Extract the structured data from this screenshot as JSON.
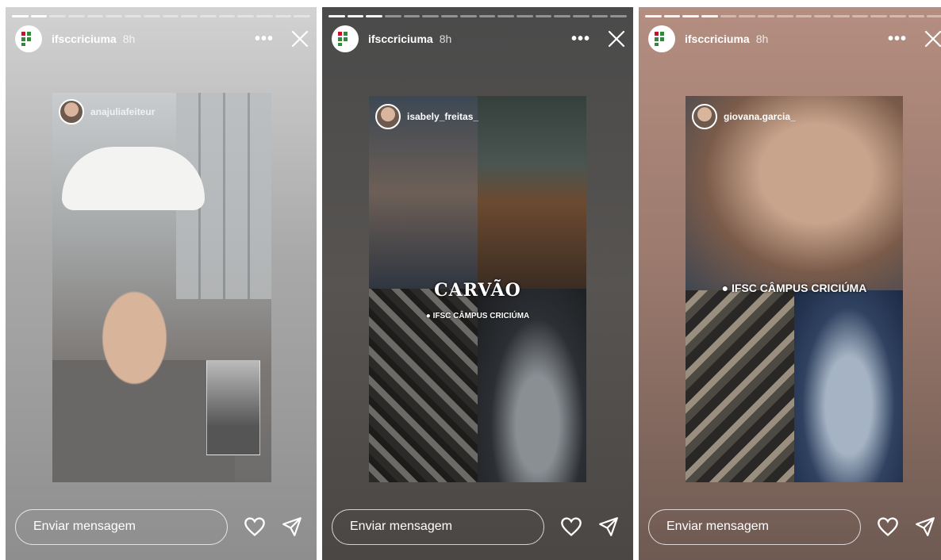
{
  "stories": [
    {
      "username": "ifsccriciuma",
      "time": "8h",
      "progress": {
        "total": 16,
        "completed": 2
      },
      "tagged_user": "anajuliafeiteur",
      "message_placeholder": "Enviar mensagem"
    },
    {
      "username": "ifsccriciuma",
      "time": "8h",
      "progress": {
        "total": 16,
        "completed": 3
      },
      "tagged_user": "isabely_freitas_",
      "sticker_text": "CARVÃO",
      "location": "IFSC CÂMPUS CRICIÚMA",
      "message_placeholder": "Enviar mensagem"
    },
    {
      "username": "ifsccriciuma",
      "time": "8h",
      "progress": {
        "total": 16,
        "completed": 4
      },
      "tagged_user": "giovana.garcia_",
      "location": "IFSC CÂMPUS CRICIÚMA",
      "message_placeholder": "Enviar mensagem"
    }
  ],
  "colors": {
    "brand_green": "#2e8b3a",
    "brand_red": "#c8102e",
    "white": "#ffffff"
  },
  "icons": [
    "more-icon",
    "close-icon",
    "heart-icon",
    "send-icon"
  ]
}
